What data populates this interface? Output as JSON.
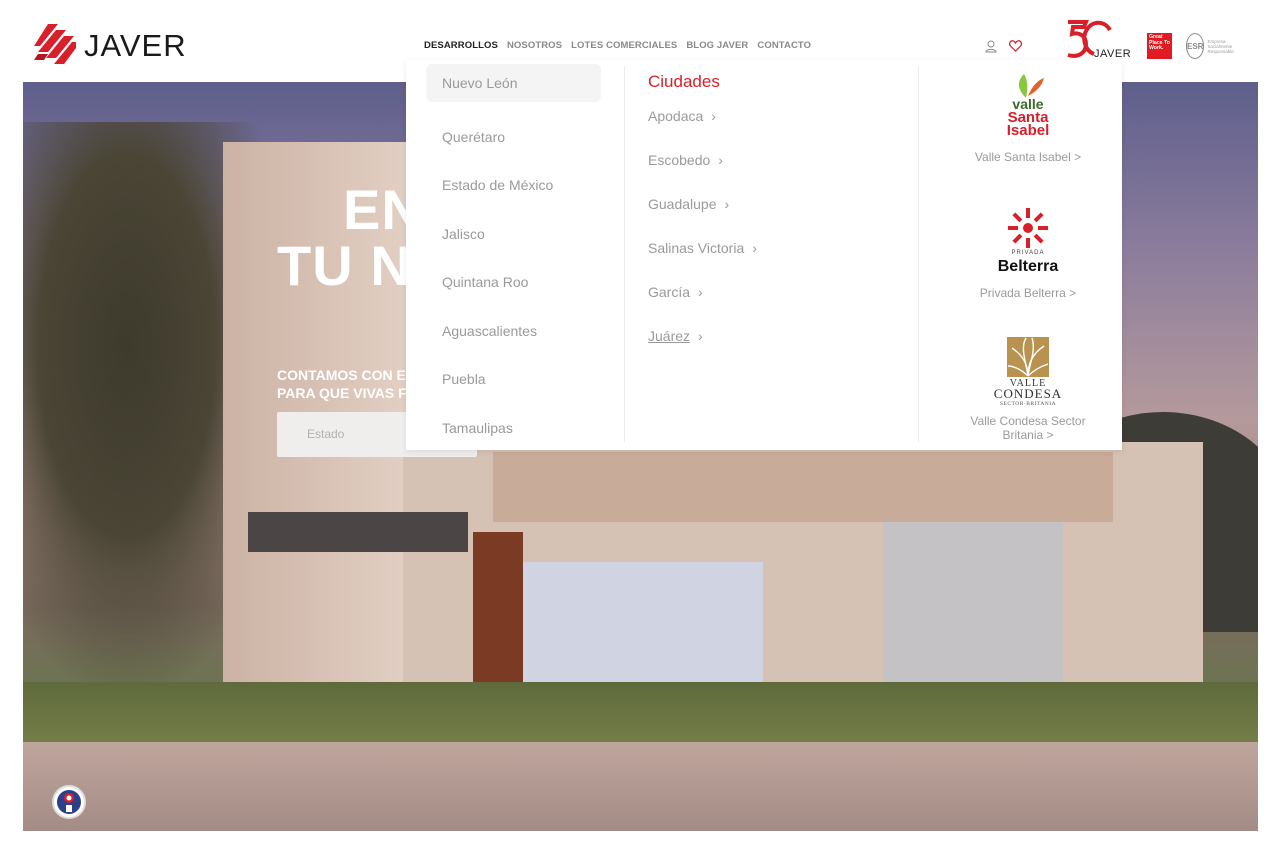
{
  "brand": {
    "name": "JAVER",
    "badge_text": "JAVER",
    "gptw_text": "Great Place To Work.",
    "esr_mark": "ESR",
    "esr_text": "Empresa Socialmente Responsable"
  },
  "nav": {
    "items": [
      "DESARROLLOS",
      "NOSOTROS",
      "LOTES COMERCIALES",
      "BLOG JAVER",
      "CONTACTO"
    ]
  },
  "hero": {
    "title_line1": "EN",
    "title_line2": "TU N",
    "sub_line1": "CONTAMOS CON E",
    "sub_line2": "PARA QUE VIVAS F",
    "estado_placeholder": "Estado"
  },
  "dropdown": {
    "states": [
      "Nuevo León",
      "Querétaro",
      "Estado de México",
      "Jalisco",
      "Quintana Roo",
      "Aguascalientes",
      "Puebla",
      "Tamaulipas"
    ],
    "cities_title": "Ciudades",
    "cities": [
      "Apodaca",
      "Escobedo",
      "Guadalupe",
      "Salinas Victoria",
      "García",
      "Juárez"
    ],
    "developments": [
      {
        "label": "Valle Santa Isabel >",
        "logo_lines": [
          "valle",
          "Santa",
          "Isabel"
        ]
      },
      {
        "label": "Privada Belterra >",
        "logo_small": "PRIVADA",
        "logo_main": "Belterra"
      },
      {
        "label": "Valle Condesa Sector Britania >",
        "logo_lines": [
          "VALLE",
          "CONDESA",
          "SECTOR·BRITANIA"
        ]
      }
    ]
  },
  "colors": {
    "accent": "#d81f2a",
    "brand_red": "#e21b23"
  }
}
